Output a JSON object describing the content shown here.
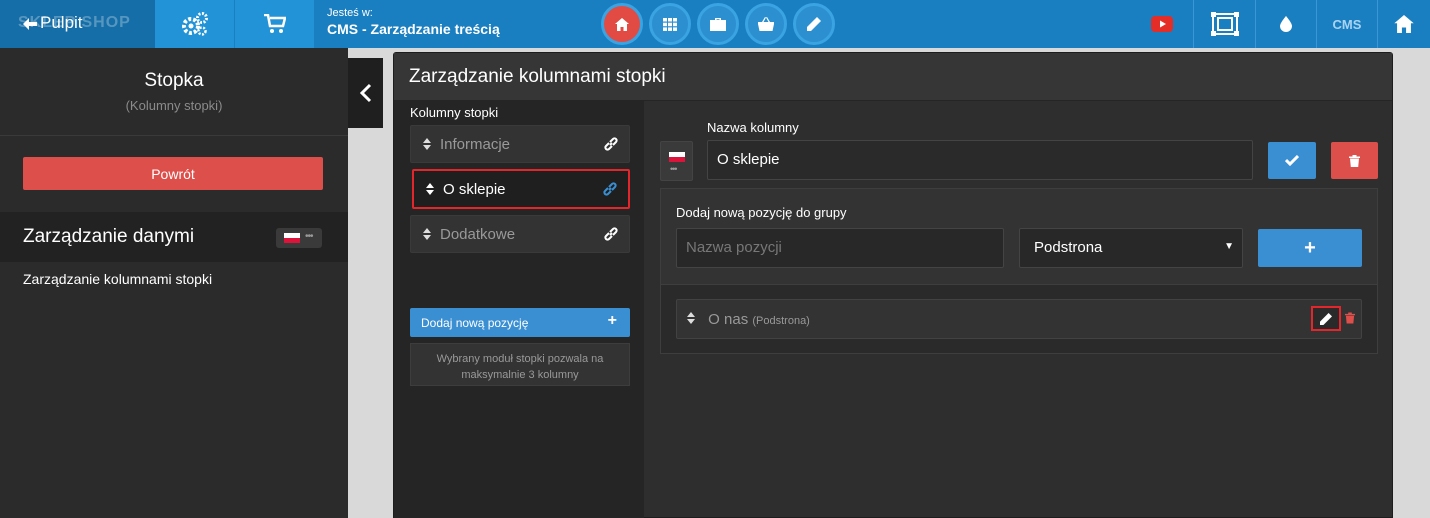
{
  "topbar": {
    "logo_ghost": "SKLEP SHOP",
    "back_label": "Pulpit",
    "location_small": "Jesteś w:",
    "location_big": "CMS - Zarządzanie treścią",
    "cms_label": "CMS",
    "icons": [
      "settings-icon",
      "cart-icon",
      "home-icon",
      "grid-icon",
      "briefcase-icon",
      "basket-icon",
      "pencil-icon",
      "youtube-icon",
      "expand-icon",
      "drop-icon",
      "home-icon"
    ]
  },
  "sidebar": {
    "title": "Stopka",
    "subtitle": "(Kolumny stopki)",
    "back_button": "Powrót",
    "data_mgmt_title": "Zarządzanie danymi",
    "link": "Zarządzanie kolumnami stopki"
  },
  "panel": {
    "title": "Zarządzanie kolumnami stopki",
    "columns_label": "Kolumny stopki",
    "columns": [
      {
        "label": "Informacje",
        "selected": false
      },
      {
        "label": "O sklepie",
        "selected": true
      },
      {
        "label": "Dodatkowe",
        "selected": false
      }
    ],
    "add_position": "Dodaj nową pozycję",
    "info_text": "Wybrany moduł stopki pozwala na maksymalnie 3 kolumny",
    "name_label": "Nazwa kolumny",
    "name_value": "O sklepie",
    "group_label": "Dodaj nową pozycję do grupy",
    "position_placeholder": "Nazwa pozycji",
    "type_selected": "Podstrona",
    "items": [
      {
        "name": "O nas",
        "type": "(Podstrona)"
      }
    ]
  },
  "colors": {
    "topbar": "#1a7fc0",
    "accent_blue": "#3a8fd3",
    "danger_red": "#dd4f4b",
    "highlight": "#e3262b"
  }
}
